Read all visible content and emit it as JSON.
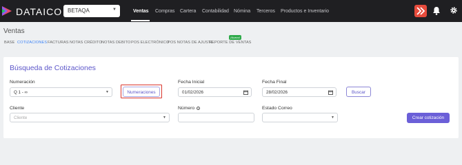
{
  "topbar": {
    "brand": "DATAICO",
    "company_select": "BETAQA",
    "nav": [
      "Ventas",
      "Compras",
      "Cartera",
      "Contabilidad",
      "Nómina",
      "Terceros",
      "Productos e Inventario"
    ],
    "active_nav": "Ventas"
  },
  "page": {
    "title": "Ventas",
    "tabs": [
      "BASE",
      "COTIZACIONES",
      "FACTURAS",
      "NOTAS CRÉDITO",
      "NOTAS DEBITO",
      "POS ELECTRÓNICO",
      "POS NOTAS DE AJUSTE",
      "REPORTE DE VENTAS"
    ],
    "active_tab": "COTIZACIONES",
    "new_badge": "¡Nuevo!"
  },
  "search": {
    "title": "Búsqueda de Cotizaciones",
    "numeracion_label": "Numeración",
    "numeracion_value": "Q 1 - ∞",
    "numeraciones_button": "Numeraciones",
    "fecha_inicial_label": "Fecha Inicial",
    "fecha_inicial_value": "01/02/2026",
    "fecha_final_label": "Fecha Final",
    "fecha_final_value": "28/02/2026",
    "buscar_button": "Buscar",
    "cliente_label": "Cliente",
    "cliente_placeholder": "Cliente",
    "numero_label": "Número",
    "estado_label": "Estado Correo",
    "crear_button": "Crear cotización"
  },
  "colors": {
    "accent": "#5b55c9",
    "primary_button": "#6b5fd8",
    "topbar": "#1f1f22",
    "highlight": "#d9342b",
    "badge": "#2eaa4a"
  }
}
